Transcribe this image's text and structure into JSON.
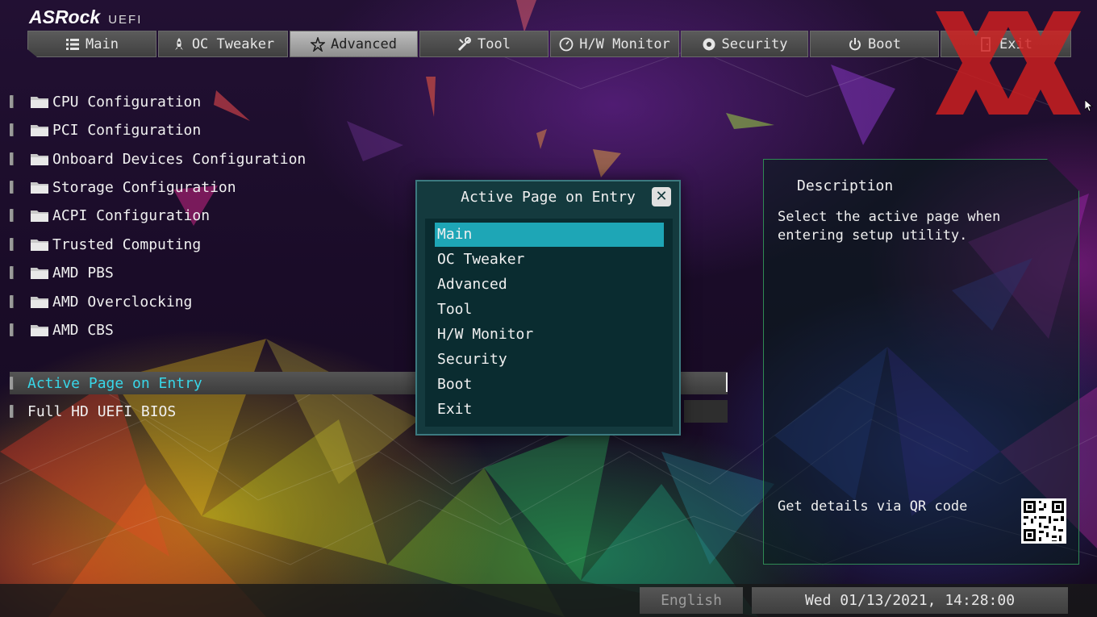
{
  "brand": {
    "logo": "ASRock",
    "product": "UEFI"
  },
  "tabs": [
    {
      "label": "Main",
      "icon": "list-icon",
      "active": false
    },
    {
      "label": "OC Tweaker",
      "icon": "rocket-icon",
      "active": false
    },
    {
      "label": "Advanced",
      "icon": "star-icon",
      "active": true
    },
    {
      "label": "Tool",
      "icon": "tools-icon",
      "active": false
    },
    {
      "label": "H/W Monitor",
      "icon": "monitor-gauge-icon",
      "active": false
    },
    {
      "label": "Security",
      "icon": "shield-gear-icon",
      "active": false
    },
    {
      "label": "Boot",
      "icon": "power-icon",
      "active": false
    },
    {
      "label": "Exit",
      "icon": "exit-door-icon",
      "active": false
    }
  ],
  "menu": {
    "folders": [
      "CPU Configuration",
      "PCI Configuration",
      "Onboard Devices Configuration",
      "Storage Configuration",
      "ACPI Configuration",
      "Trusted Computing",
      "AMD PBS",
      "AMD Overclocking",
      "AMD CBS"
    ],
    "settings": [
      {
        "label": "Active Page on Entry",
        "selected": true
      },
      {
        "label": "Full HD UEFI BIOS",
        "selected": false
      }
    ]
  },
  "popup": {
    "title": "Active Page on Entry",
    "options": [
      "Main",
      "OC Tweaker",
      "Advanced",
      "Tool",
      "H/W Monitor",
      "Security",
      "Boot",
      "Exit"
    ],
    "selected": "Main"
  },
  "description": {
    "title": "Description",
    "text": "Select the active page when entering setup utility.",
    "qr_label": "Get details via QR code"
  },
  "footer": {
    "language": "English",
    "datetime": "Wed 01/13/2021, 14:28:00"
  },
  "colors": {
    "accent": "#1ea6b6",
    "highlight_text": "#38d6e8",
    "panel_border": "#2f8a54",
    "watermark": "#d22020"
  }
}
